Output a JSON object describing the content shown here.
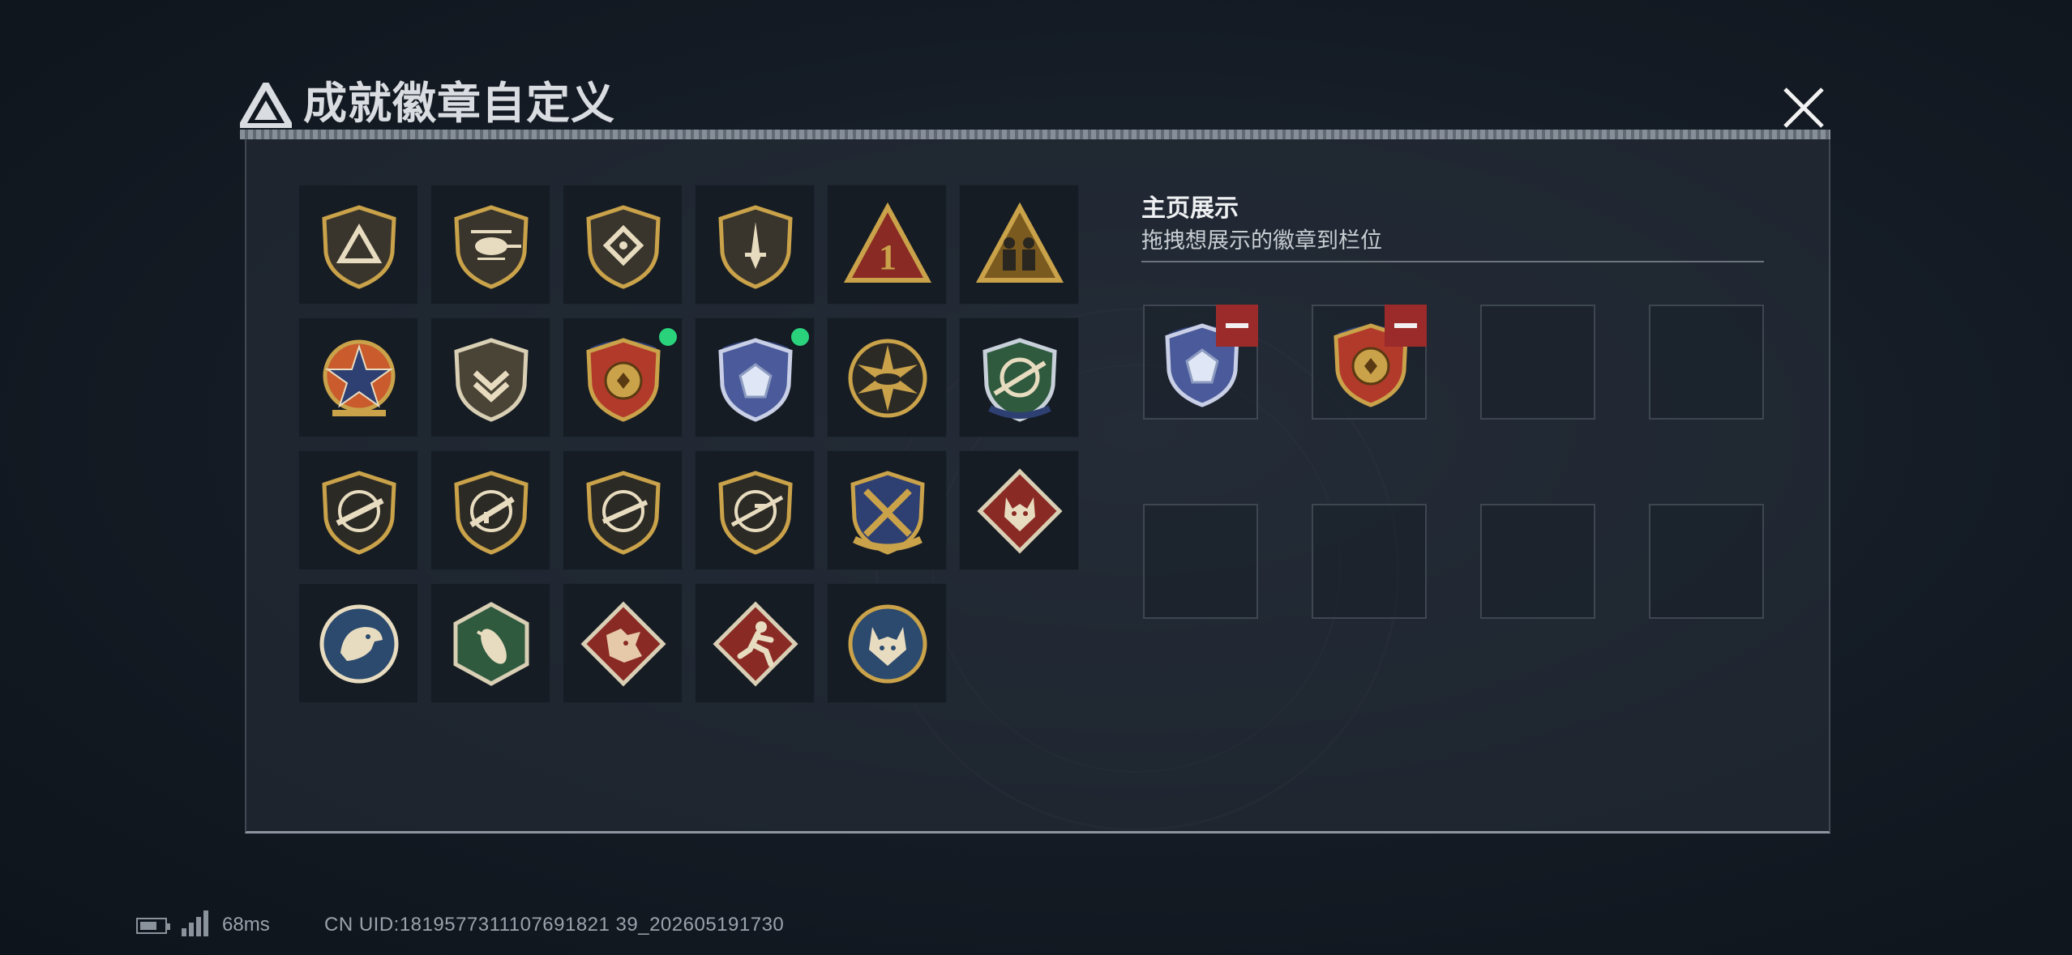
{
  "window": {
    "title": "成就徽章自定义"
  },
  "badges": [
    {
      "icon": "triangle-logo-badge-icon",
      "new": false
    },
    {
      "icon": "helicopter-badge-icon",
      "new": false
    },
    {
      "icon": "diamond-emblem-badge-icon",
      "new": false
    },
    {
      "icon": "dagger-badge-icon",
      "new": false
    },
    {
      "icon": "rank-one-badge-icon",
      "new": false
    },
    {
      "icon": "soldiers-badge-icon",
      "new": false
    },
    {
      "icon": "star-medal-badge-icon",
      "new": false
    },
    {
      "icon": "chevron-shield-badge-icon",
      "new": false
    },
    {
      "icon": "gold-shield-badge-icon",
      "new": true
    },
    {
      "icon": "crystal-shield-badge-icon",
      "new": true
    },
    {
      "icon": "sunburst-badge-icon",
      "new": false
    },
    {
      "icon": "sniper-crest-badge-icon",
      "new": false
    },
    {
      "icon": "rifle-badge-icon",
      "new": false
    },
    {
      "icon": "assault-rifle-badge-icon",
      "new": false
    },
    {
      "icon": "shotgun-badge-icon",
      "new": false
    },
    {
      "icon": "sniper-rifle-badge-icon",
      "new": false
    },
    {
      "icon": "crossed-weapons-badge-icon",
      "new": false
    },
    {
      "icon": "wolf-badge-icon",
      "new": false
    },
    {
      "icon": "eagle-badge-icon",
      "new": false
    },
    {
      "icon": "hornet-badge-icon",
      "new": false
    },
    {
      "icon": "dragon-badge-icon",
      "new": false
    },
    {
      "icon": "runner-badge-icon",
      "new": false
    },
    {
      "icon": "lynx-badge-icon",
      "new": false
    }
  ],
  "showcase": {
    "title": "主页展示",
    "description": "拖拽想展示的徽章到栏位",
    "slots": [
      {
        "badge": "crystal-shield-badge-icon",
        "remove_label": "remove"
      },
      {
        "badge": "gold-shield-badge-icon",
        "remove_label": "remove"
      },
      {
        "badge": null
      },
      {
        "badge": null
      },
      {
        "badge": null
      },
      {
        "badge": null
      },
      {
        "badge": null
      },
      {
        "badge": null
      }
    ]
  },
  "status": {
    "ping": "68ms",
    "uid": "CN UID:1819577311107691821 39_202605191730"
  },
  "colors": {
    "accent_green": "#2ad27c",
    "remove_red": "#9b2b2b",
    "gold": "#c9a24a"
  }
}
